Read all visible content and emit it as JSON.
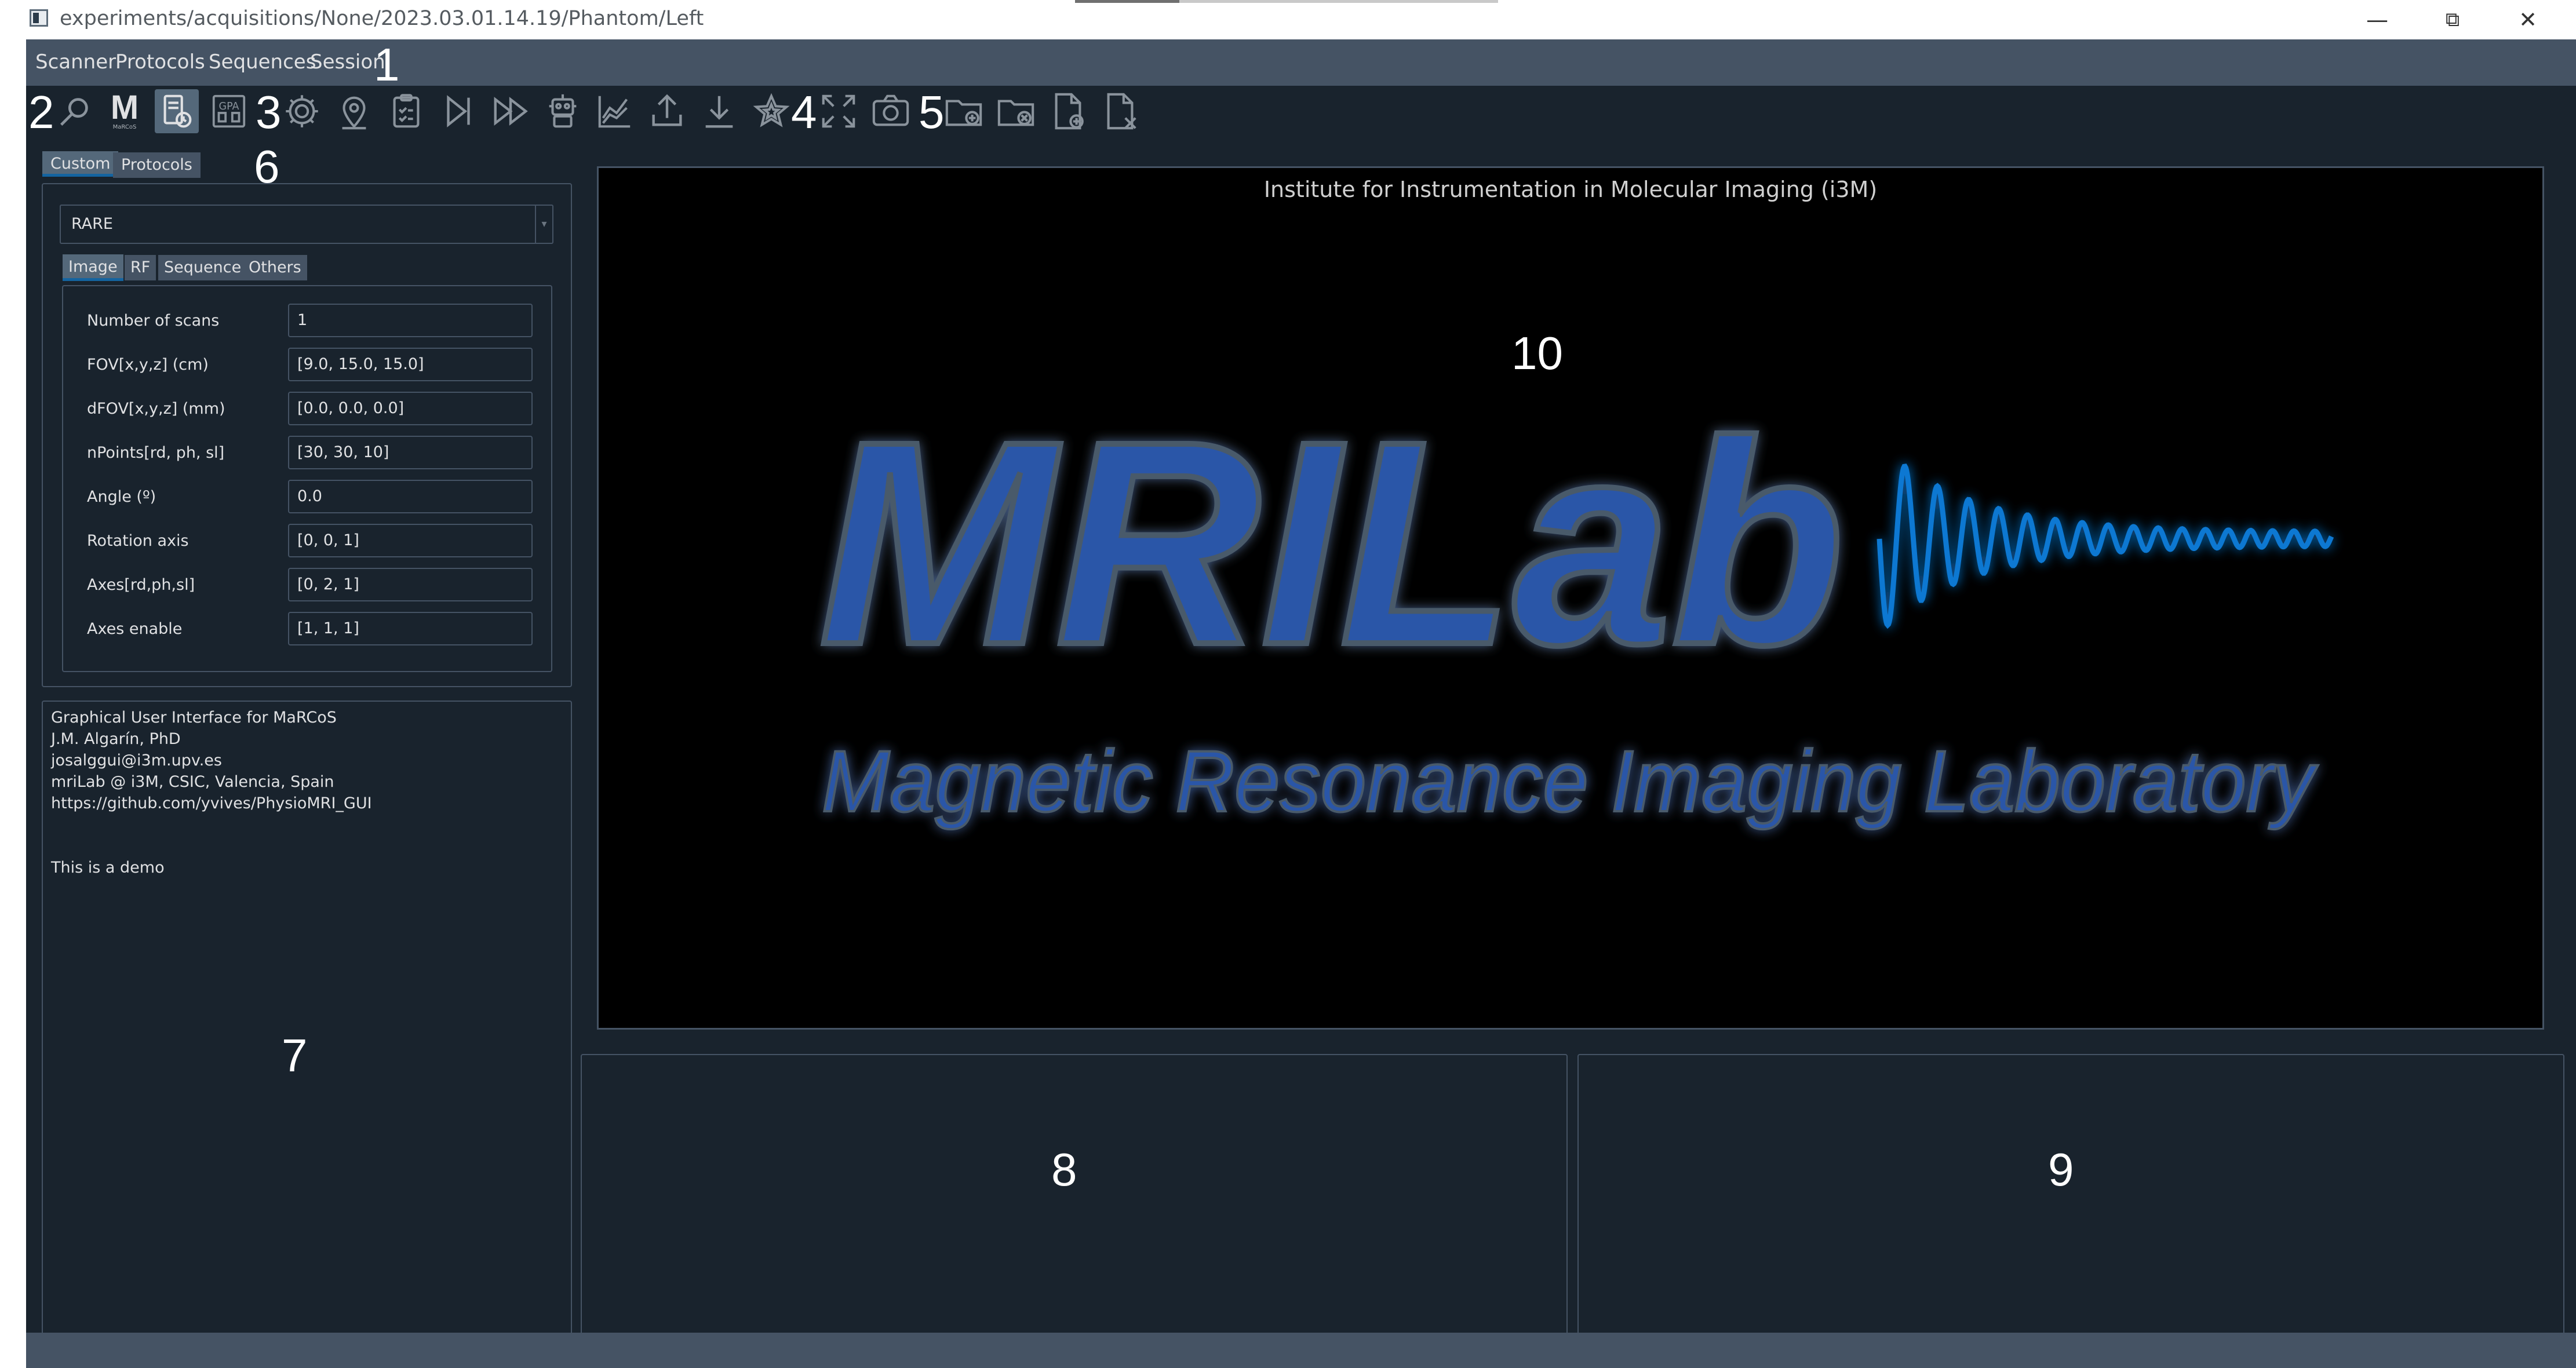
{
  "window": {
    "title": "experiments/acquisitions/None/2023.03.01.14.19/Phantom/Left",
    "minimize_glyph": "—",
    "maximize_glyph": "⧉",
    "close_glyph": "✕"
  },
  "menu": [
    "Scanner",
    "Protocols",
    "Sequences",
    "Session"
  ],
  "toolbar": {
    "icons": [
      "search-icon",
      "marcos-logo-icon",
      "scanner-status-icon",
      "gpa-icon",
      "settings-gear-icon",
      "location-pin-icon",
      "clipboard-check-icon",
      "step-forward-icon",
      "fast-forward-icon",
      "robot-icon",
      "chart-icon",
      "upload-icon",
      "download-icon",
      "star-icon",
      "fullscreen-icon",
      "camera-icon",
      "new-folder-icon",
      "remove-folder-icon",
      "new-file-icon",
      "remove-file-icon"
    ],
    "marcos_letter": "M",
    "marcos_caption": "MaRCoS",
    "gpa_text": "GPA",
    "active_icon": "scanner-status-icon"
  },
  "callouts": [
    "1",
    "2",
    "3",
    "4",
    "5",
    "6",
    "7",
    "8",
    "9",
    "10"
  ],
  "left_tabs": {
    "items": [
      "Custom",
      "Protocols"
    ],
    "selected": "Custom"
  },
  "sequence_select": {
    "value": "RARE"
  },
  "param_tabs": {
    "items": [
      "Image",
      "RF",
      "Sequence",
      "Others"
    ],
    "selected": "Image"
  },
  "parameters": [
    {
      "label": "Number of scans",
      "value": "1"
    },
    {
      "label": "FOV[x,y,z] (cm)",
      "value": "[9.0, 15.0, 15.0]"
    },
    {
      "label": "dFOV[x,y,z] (mm)",
      "value": "[0.0, 0.0, 0.0]"
    },
    {
      "label": "nPoints[rd, ph, sl]",
      "value": "[30, 30, 10]"
    },
    {
      "label": "Angle (º)",
      "value": "0.0"
    },
    {
      "label": "Rotation axis",
      "value": "[0, 0, 1]"
    },
    {
      "label": "Axes[rd,ph,sl]",
      "value": "[0, 2, 1]"
    },
    {
      "label": "Axes enable",
      "value": "[1, 1, 1]"
    }
  ],
  "console": {
    "lines": [
      "Graphical User Interface for MaRCoS",
      "J.M. Algarín, PhD",
      "josalggui@i3m.upv.es",
      "mriLab @ i3M, CSIC, Valencia, Spain",
      "https://github.com/yvives/PhysioMRI_GUI",
      "",
      "",
      "This is a demo"
    ]
  },
  "main_plot": {
    "title": "Institute for Instrumentation in Molecular Imaging (i3M)",
    "logo_text": "MRILab",
    "logo_subtitle": "Magnetic Resonance Imaging Laboratory",
    "logo_color": "#2a56a8",
    "wave_color": "#0a78d2"
  },
  "colors": {
    "background": "#19232d",
    "bar": "#455364",
    "accent": "#1464a0",
    "text": "#e0e1e3"
  }
}
